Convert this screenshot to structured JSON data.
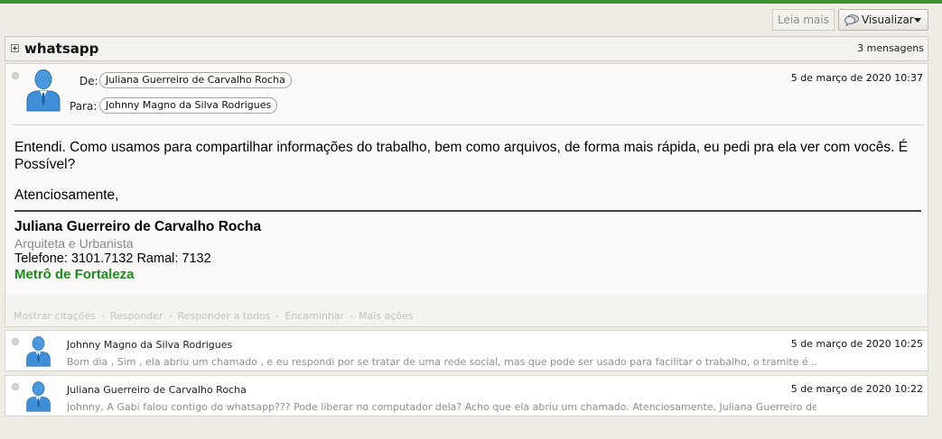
{
  "toolbar": {
    "read_more_label": "Leia mais",
    "view_label": "Visualizar"
  },
  "thread": {
    "title": "whatsapp",
    "count": "3 mensagens"
  },
  "open_message": {
    "from_label": "De:",
    "from": "Juliana Guerreiro de Carvalho Rocha",
    "to_label": "Para:",
    "to": "Johnny Magno da Silva Rodrigues",
    "date": "5 de março de 2020 10:37",
    "body": "Entendi. Como usamos para compartilhar informações do trabalho, bem como arquivos, de forma mais rápida, eu pedi pra ela ver com vocês. É Possível?",
    "regards": "Atenciosamente,",
    "signature": {
      "name": "Juliana Guerreiro de Carvalho Rocha",
      "role": "Arquiteta e Urbanista",
      "phone": "Telefone: 3101.7132 Ramal: 7132",
      "org": "Metrô de Fortaleza",
      "org_color": "#1d8a1d"
    },
    "actions": {
      "show_quotes": "Mostrar citações",
      "reply": "Responder",
      "reply_all": "Responder a todos",
      "forward": "Encaminhar",
      "more": "Mais ações",
      "separator": "-"
    }
  },
  "collapsed_messages": [
    {
      "sender": "Johnny Magno da Silva Rodrigues",
      "date": "5 de março de 2020 10:25",
      "preview": "Bom dia , Sim , ela abriu um chamado , e eu respondi por se tratar de uma rede social, mas que pode ser usado para facilitar o trabalho, o tramite é ..."
    },
    {
      "sender": "Juliana Guerreiro de Carvalho Rocha",
      "date": "5 de março de 2020 10:22",
      "preview": "Johnny, A Gabi falou contigo do whatsapp??? Pode liberar no computador dela? Acho que ela abriu um chamado. Atenciosamente, Juliana Guerreiro de ..."
    }
  ],
  "colors": {
    "top_bar": "#3d8f2f",
    "avatar_blue": "#3e8fd8"
  },
  "icons": {
    "view": "speech-bubble-icon",
    "expand": "plus-box-icon",
    "avatar": "user-avatar-icon"
  }
}
